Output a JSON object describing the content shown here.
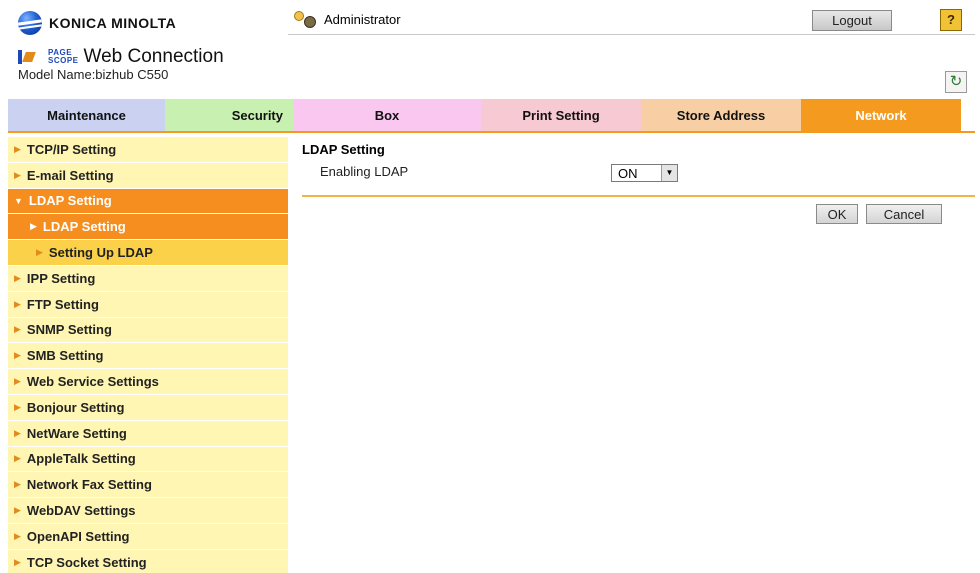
{
  "header": {
    "brand": "KONICA MINOLTA",
    "pagescope_small_top": "PAGE",
    "pagescope_small_bottom": "SCOPE",
    "product": "Web Connection",
    "model": "Model Name:bizhub C550",
    "user": "Administrator",
    "logout_label": "Logout",
    "help_label": "?",
    "refresh_icon": "refresh-icon"
  },
  "tabs": [
    {
      "label": "Maintenance",
      "color": "#cbd2f1"
    },
    {
      "label": "Security",
      "color": "#c8f0b0"
    },
    {
      "label": "Box",
      "color": "#f9c7f0"
    },
    {
      "label": "Print Setting",
      "color": "#f6c9d3"
    },
    {
      "label": "Store Address",
      "color": "#f8cfa4"
    },
    {
      "label": "Network",
      "color": "#f49a1e",
      "active": true
    }
  ],
  "sidebar": {
    "items": [
      {
        "label": "TCP/IP Setting"
      },
      {
        "label": "E-mail Setting"
      },
      {
        "label": "LDAP Setting",
        "expanded": true
      },
      {
        "label": "LDAP Setting",
        "sub": true,
        "active": true
      },
      {
        "label": "Setting Up LDAP",
        "sub": true
      },
      {
        "label": "IPP Setting"
      },
      {
        "label": "FTP Setting"
      },
      {
        "label": "SNMP Setting"
      },
      {
        "label": "SMB Setting"
      },
      {
        "label": "Web Service Settings"
      },
      {
        "label": "Bonjour Setting"
      },
      {
        "label": "NetWare Setting"
      },
      {
        "label": "AppleTalk Setting"
      },
      {
        "label": "Network Fax Setting"
      },
      {
        "label": "WebDAV Settings"
      },
      {
        "label": "OpenAPI Setting"
      },
      {
        "label": "TCP Socket Setting"
      }
    ]
  },
  "main": {
    "title": "LDAP Setting",
    "field_label": "Enabling LDAP",
    "field_value": "ON",
    "ok_label": "OK",
    "cancel_label": "Cancel"
  },
  "colors": {
    "accent": "#f49a1e",
    "sidebar_bg": "#fff6b3",
    "sidebar_sub": "#fbd14a"
  }
}
